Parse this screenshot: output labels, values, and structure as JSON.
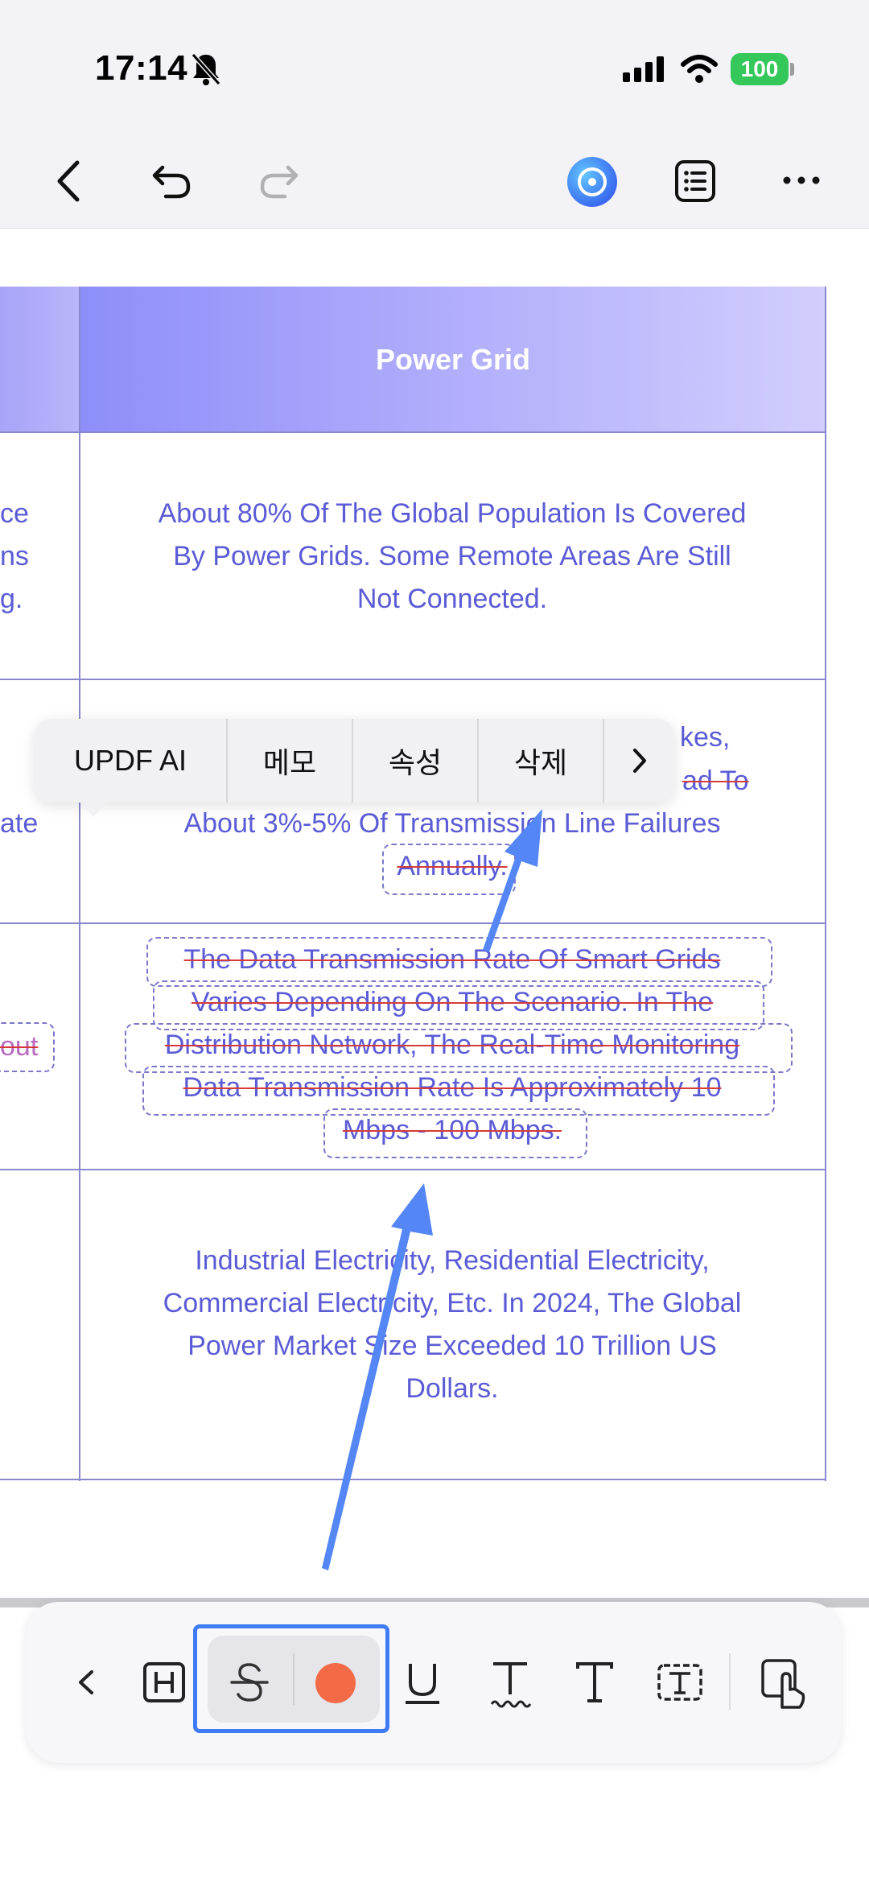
{
  "status_bar": {
    "time": "17:14",
    "battery": "100"
  },
  "table": {
    "header": "Power Grid",
    "rows": [
      {
        "lines": [
          "About 80% Of The Global Population Is Covered",
          "By Power Grids. Some Remote Areas Are Still",
          "Not Connected."
        ]
      },
      {
        "line_right1": "kes,",
        "line_right2": "ad To",
        "line3": "About 3%-5% Of Transmission Line Failures",
        "line4": "Annually."
      },
      {
        "lines": [
          "The Data Transmission Rate Of Smart Grids",
          "Varies Depending On The Scenario. In The",
          "Distribution Network, The Real-Time Monitoring",
          "Data Transmission Rate Is Approximately 10",
          "Mbps - 100 Mbps."
        ]
      },
      {
        "lines": [
          "Industrial Electricity, Residential Electricity,",
          "Commercial Electricity, Etc. In 2024, The Global",
          "Power Market Size Exceeded 10 Trillion US",
          "Dollars."
        ]
      }
    ],
    "left_edge": [
      "ce",
      "ns",
      "g.",
      "ate",
      "out"
    ]
  },
  "context_menu": {
    "items": [
      "UPDF AI",
      "메모",
      "속성",
      "삭제"
    ],
    "more_icon": "chevron-right-icon"
  },
  "toolbar": {
    "icons": [
      "chevron-left-icon",
      "highlight-icon",
      "strikethrough-icon",
      "color-dot",
      "underline-icon",
      "squiggly-icon",
      "text-icon",
      "textbox-icon",
      "tap-select-icon"
    ],
    "color": "#f36a46",
    "accent": "#3f7bf4"
  }
}
